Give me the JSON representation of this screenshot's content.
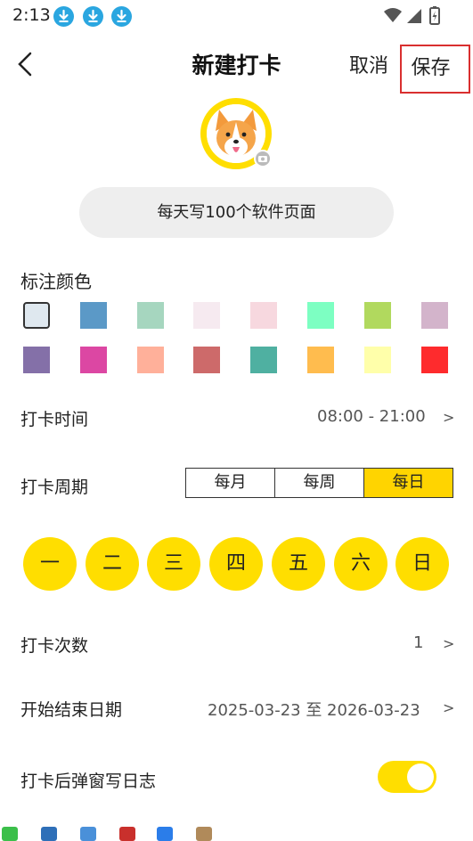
{
  "status_bar": {
    "time": "2:13",
    "notification_icons": [
      "download-icon",
      "download-icon",
      "download-icon"
    ],
    "right_icons": [
      "wifi-icon",
      "signal-icon",
      "battery-icon"
    ]
  },
  "header": {
    "back_icon": "chevron-left-icon",
    "title": "新建打卡",
    "cancel_label": "取消",
    "save_label": "保存",
    "highlight_color": "#d92f2f"
  },
  "avatar": {
    "image": "corgi-avatar",
    "border_color": "#ffde00",
    "camera_icon": "camera-icon"
  },
  "task_name": {
    "value": "每天写100个软件页面"
  },
  "color_section": {
    "label": "标注颜色",
    "selected_index": 0,
    "colors": [
      "#dfe8ef",
      "#5b99c7",
      "#a6d6bf",
      "#f6eaf0",
      "#f7d8df",
      "#7dffc2",
      "#b1d95e",
      "#d3b4cb",
      "#8470a8",
      "#dc47a3",
      "#ffb09a",
      "#cd6a6a",
      "#4fb0a1",
      "#ffbc4e",
      "#ffffaa",
      "#fe2b2d"
    ]
  },
  "checkin_time": {
    "label": "打卡时间",
    "value": "08:00 - 21:00",
    "chevron": ">"
  },
  "checkin_cycle": {
    "label": "打卡周期",
    "options": [
      "每月",
      "每周",
      "每日"
    ],
    "selected": "每日",
    "accent_color": "#ffd400"
  },
  "weekdays": [
    "一",
    "二",
    "三",
    "四",
    "五",
    "六",
    "日"
  ],
  "checkin_count": {
    "label": "打卡次数",
    "value": "1",
    "chevron": ">"
  },
  "date_range": {
    "label": "开始结束日期",
    "value": "2025-03-23 至 2026-03-23",
    "chevron": ">"
  },
  "popup_diary": {
    "label": "打卡后弹窗写日志",
    "enabled": true
  },
  "dock_icons": [
    "wechat-icon",
    "pen-icon",
    "notes-icon",
    "calendar-icon",
    "app-icon",
    "box-icon"
  ]
}
